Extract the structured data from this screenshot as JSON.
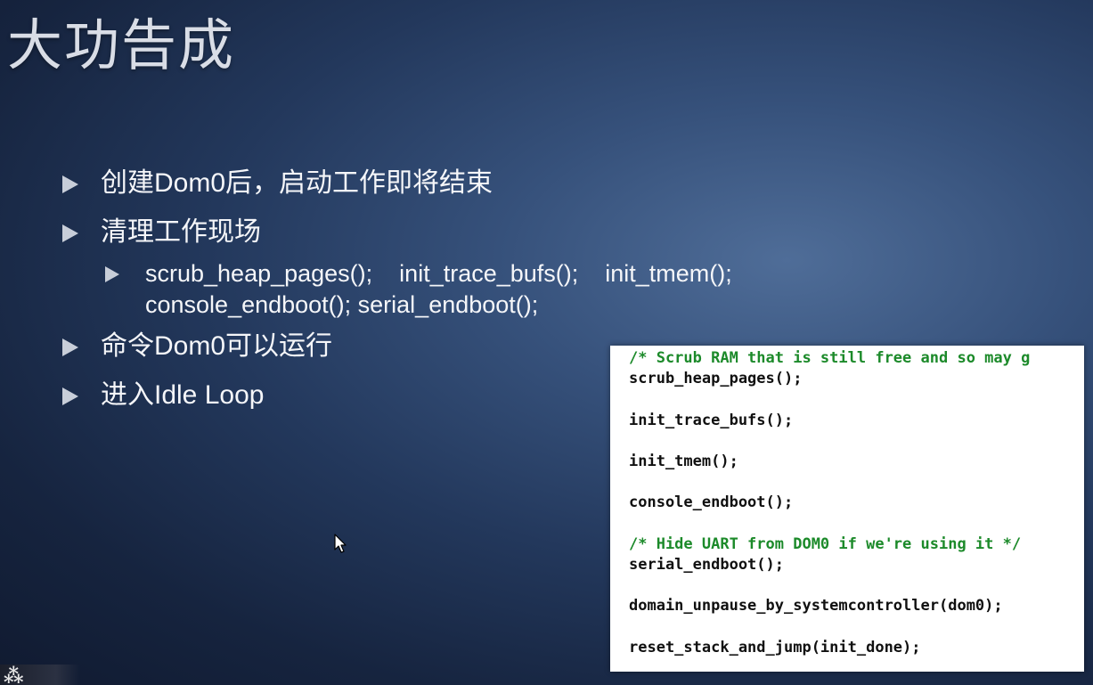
{
  "slide": {
    "title": "大功告成",
    "bullets": [
      {
        "text": "创建Dom0后，启动工作即将结束"
      },
      {
        "text": "清理工作现场",
        "sub": "scrub_heap_pages();    init_trace_bufs();    init_tmem();\nconsole_endboot(); serial_endboot();"
      },
      {
        "text": "命令Dom0可以运行"
      },
      {
        "text": "进入Idle Loop"
      }
    ]
  },
  "code_panel": {
    "lines": [
      {
        "text": "/* Scrub RAM that is still free and so may g",
        "kind": "comment"
      },
      {
        "text": "scrub_heap_pages();",
        "kind": "code"
      },
      {
        "text": "",
        "kind": "blank"
      },
      {
        "text": "init_trace_bufs();",
        "kind": "code"
      },
      {
        "text": "",
        "kind": "blank"
      },
      {
        "text": "init_tmem();",
        "kind": "code"
      },
      {
        "text": "",
        "kind": "blank"
      },
      {
        "text": "console_endboot();",
        "kind": "code"
      },
      {
        "text": "",
        "kind": "blank"
      },
      {
        "text": "/* Hide UART from DOM0 if we're using it */",
        "kind": "comment"
      },
      {
        "text": "serial_endboot();",
        "kind": "code"
      },
      {
        "text": "",
        "kind": "blank"
      },
      {
        "text": "domain_unpause_by_systemcontroller(dom0);",
        "kind": "code"
      },
      {
        "text": "",
        "kind": "blank"
      },
      {
        "text": "reset_stack_and_jump(init_done);",
        "kind": "code"
      }
    ]
  },
  "colors": {
    "comment": "#1c8a2a",
    "code": "#101010",
    "bullet_marker": "#c8ced9"
  },
  "icons": {
    "cursor": "mouse-pointer-icon",
    "bullet": "triangle-bullet-icon"
  }
}
